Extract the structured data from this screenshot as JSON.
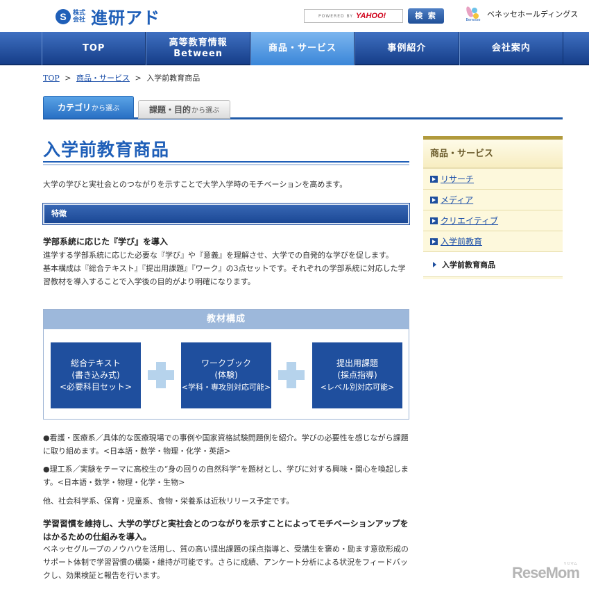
{
  "header": {
    "logo_mark": "S",
    "logo_small": "株式会社",
    "logo_text": "進研アド",
    "search_powered": "POWERED BY",
    "search_yahoo": "YAHOO!",
    "search_button": "検 索",
    "benesse_label": "Benesse",
    "benesse_text": "ベネッセホールディングス"
  },
  "nav": {
    "items": [
      {
        "label": "TOP",
        "sub": ""
      },
      {
        "label": "高等教育情報",
        "sub": "Between"
      },
      {
        "label": "商品・サービス",
        "sub": ""
      },
      {
        "label": "事例紹介",
        "sub": ""
      },
      {
        "label": "会社案内",
        "sub": ""
      }
    ]
  },
  "breadcrumb": {
    "top": "TOP",
    "products": "商品・サービス",
    "current": "入学前教育商品",
    "sep": ">"
  },
  "tabs": {
    "tab1_main": "カテゴリ",
    "tab1_small": "から選ぶ",
    "tab2_main": "課題・目的",
    "tab2_small": "から選ぶ"
  },
  "main": {
    "title": "入学前教育商品",
    "intro": "大学の学びと実社会とのつながりを示すことで大学入学時のモチベーションを高めます。",
    "section_label": "特徴",
    "feat_head": "学部系統に応じた『学び』を導入",
    "feat_line1": "進学する学部系統に応じた必要な『学び』や『意義』を理解させ、大学での自発的な学びを促します。",
    "feat_line2": "基本構成は『総合テキスト』『提出用課題』『ワーク』の3点セットです。それぞれの学部系統に対応した学習教材を導入することで入学後の目的がより明確になります。",
    "materials": {
      "heading": "教材構成",
      "cards": [
        {
          "l1": "総合テキスト",
          "l2": "(書き込み式)",
          "l3": "<必要科目セット>"
        },
        {
          "l1": "ワークブック",
          "l2": "(体験)",
          "l3": "<学科・専攻別対応可能>"
        },
        {
          "l1": "提出用課題",
          "l2": "(採点指導)",
          "l3": "<レベル別対応可能>"
        }
      ]
    },
    "para1": "●看護・医療系／具体的な医療現場での事例や国家資格試験問題例を紹介。学びの必要性を感じながら課題に取り組めます。<日本語・数学・物理・化学・英語>",
    "para2": "●理工系／実験をテーマに高校生の“身の回りの自然科学”を題材とし、学びに対する興味・関心を喚起します。<日本語・数学・物理・化学・生物>",
    "para3": "他、社会科学系、保育・児童系、食物・栄養系は近秋リリース予定です。",
    "sub_head": "学習習慣を維持し、大学の学びと実社会とのつながりを示すことによってモチベーションアップをはかるための仕組みを導入。",
    "para4": "ベネッセグループのノウハウを活用し、質の高い提出課題の採点指導と、受講生を褒め・励ます意欲形成のサポート体制で学習習慣の構築・維持が可能です。さらに成績、アンケート分析による状況をフィードバックし、効果検証と報告を行います。"
  },
  "sidebar": {
    "title": "商品・サービス",
    "items": [
      "リサーチ",
      "メディア",
      "クリエイティブ",
      "入学前教育"
    ],
    "current": "入学前教育商品"
  },
  "watermark": {
    "text": "ReseMom",
    "small": "リセマム"
  }
}
